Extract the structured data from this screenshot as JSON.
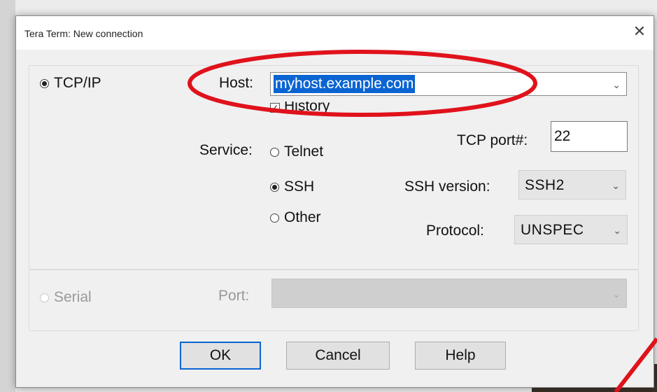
{
  "window": {
    "title": "Tera Term: New connection",
    "close_glyph": "✕"
  },
  "tcpip": {
    "label": "TCP/IP",
    "selected": true,
    "host_label": "Host:",
    "host_value": "myhost.example.com",
    "history_label": "History",
    "history_checked": true,
    "service_label": "Service:",
    "services": [
      "Telnet",
      "SSH",
      "Other"
    ],
    "service_selected": "SSH",
    "tcp_port_label": "TCP port#:",
    "tcp_port_value": "22",
    "ssh_version_label": "SSH version:",
    "ssh_version_value": "SSH2",
    "protocol_label": "Protocol:",
    "protocol_value": "UNSPEC"
  },
  "serial": {
    "label": "Serial",
    "selected": false,
    "enabled": false,
    "port_label": "Port:",
    "port_value": ""
  },
  "buttons": {
    "ok": "OK",
    "cancel": "Cancel",
    "help": "Help"
  },
  "colors": {
    "selection": "#0a64d2",
    "annotation": "#e0121b",
    "dialog_bg": "#f0f0f0"
  },
  "icons": {
    "dropdown": "chevron-down-icon",
    "close": "close-icon"
  }
}
